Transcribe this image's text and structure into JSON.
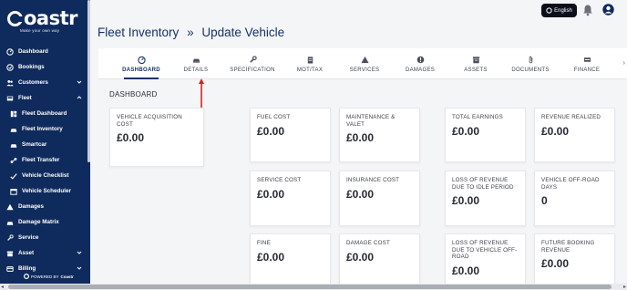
{
  "brand": {
    "logo_rest": "oastr",
    "tagline": "Make your own way",
    "powered_by": "POWERED BY",
    "powered_brand": "Coastr"
  },
  "nav": [
    {
      "label": "Dashboard",
      "icon": "dashboard-icon"
    },
    {
      "label": "Bookings",
      "icon": "bookings-icon"
    },
    {
      "label": "Customers",
      "icon": "customers-icon",
      "chevron": "down"
    },
    {
      "label": "Fleet",
      "icon": "fleet-icon",
      "chevron": "up"
    },
    {
      "label": "Fleet Dashboard",
      "icon": "fleet-dashboard-icon"
    },
    {
      "label": "Fleet Inventory",
      "icon": "fleet-inventory-icon"
    },
    {
      "label": "Smartcar",
      "icon": "smartcar-icon"
    },
    {
      "label": "Fleet Transfer",
      "icon": "fleet-transfer-icon"
    },
    {
      "label": "Vehicle Checklist",
      "icon": "vehicle-checklist-icon"
    },
    {
      "label": "Vehicle Scheduler",
      "icon": "vehicle-scheduler-icon"
    },
    {
      "label": "Damages",
      "icon": "damages-icon"
    },
    {
      "label": "Damage Matrix",
      "icon": "damage-matrix-icon"
    },
    {
      "label": "Service",
      "icon": "service-icon"
    },
    {
      "label": "Asset",
      "icon": "asset-icon",
      "chevron": "down"
    },
    {
      "label": "Billing",
      "icon": "billing-icon",
      "chevron": "down"
    }
  ],
  "topbar": {
    "language": "English"
  },
  "breadcrumb": {
    "parent": "Fleet Inventory",
    "separator": "»",
    "current": "Update Vehicle"
  },
  "tabs": [
    {
      "label": "DASHBOARD",
      "icon": "gauge-icon",
      "active": true
    },
    {
      "label": "DETAILS",
      "icon": "car-icon"
    },
    {
      "label": "SPECIFICATION",
      "icon": "wrench-icon"
    },
    {
      "label": "MOT/TAX",
      "icon": "clipboard-icon"
    },
    {
      "label": "SERVICES",
      "icon": "warning-icon"
    },
    {
      "label": "DAMAGES",
      "icon": "info-icon"
    },
    {
      "label": "ASSETS",
      "icon": "archive-icon"
    },
    {
      "label": "DOCUMENTS",
      "icon": "paperclip-icon"
    },
    {
      "label": "FINANCE",
      "icon": "money-icon"
    }
  ],
  "section_title": "DASHBOARD",
  "cards": [
    {
      "label": "VEHICLE ACQUISITION COST",
      "value": "£0.00"
    },
    {
      "label": "FUEL COST",
      "value": "£0.00"
    },
    {
      "label": "MAINTENANCE & VALET",
      "value": "£0.00"
    },
    {
      "label": "TOTAL EARNINGS",
      "value": "£0.00"
    },
    {
      "label": "REVENUE REALIZED",
      "value": "£0.00"
    },
    {
      "label": "SERVICE COST",
      "value": "£0.00"
    },
    {
      "label": "INSURANCE COST",
      "value": "£0.00"
    },
    {
      "label": "LOSS OF REVENUE DUE TO IDLE PERIOD",
      "value": "£0.00"
    },
    {
      "label": "VEHICLE OFF-ROAD DAYS",
      "value": "0"
    },
    {
      "label": "FINE",
      "value": "£0.00"
    },
    {
      "label": "DAMAGE COST",
      "value": "£0.00"
    },
    {
      "label": "LOSS OF REVENUE DUE TO VEHICLE OFF-ROAD",
      "value": "£0.00"
    },
    {
      "label": "FUTURE BOOKING REVENUE",
      "value": "£0.00"
    }
  ],
  "colors": {
    "sidebar": "#0f2a5c",
    "title": "#14326b",
    "annotation_arrow": "#d9221c"
  }
}
